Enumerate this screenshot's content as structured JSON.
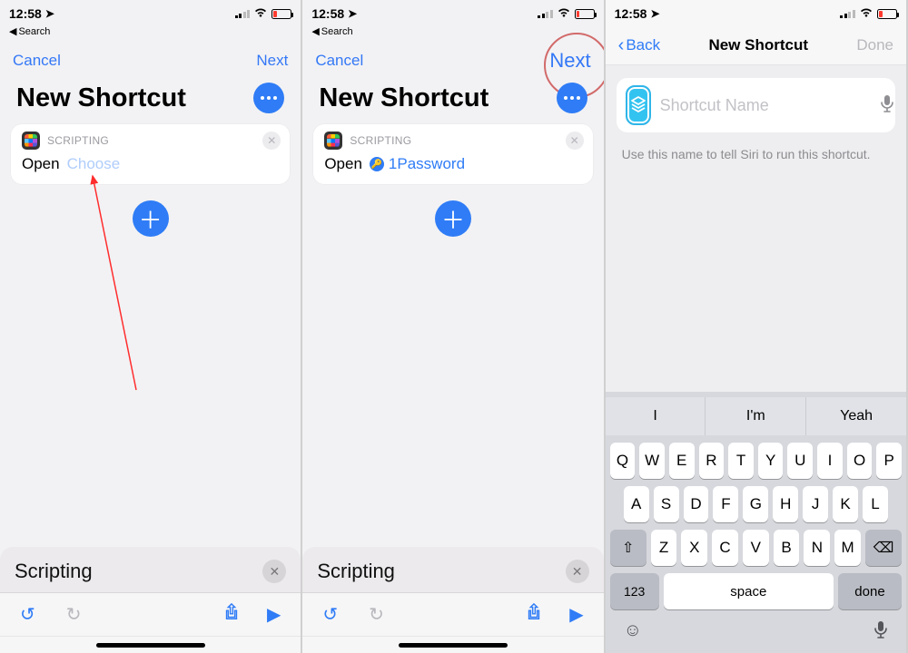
{
  "status": {
    "time": "12:58",
    "back_app": "Search"
  },
  "panel1": {
    "nav": {
      "cancel": "Cancel",
      "next": "Next"
    },
    "title": "New Shortcut",
    "card": {
      "label": "SCRIPTING",
      "open": "Open",
      "param_placeholder": "Choose"
    },
    "search": {
      "text": "Scripting"
    }
  },
  "panel2": {
    "nav": {
      "cancel": "Cancel",
      "next": "Next"
    },
    "title": "New Shortcut",
    "card": {
      "label": "SCRIPTING",
      "open": "Open",
      "app_name": "1Password"
    },
    "search": {
      "text": "Scripting"
    }
  },
  "panel3": {
    "nav": {
      "back": "Back",
      "title": "New Shortcut",
      "done": "Done"
    },
    "field": {
      "placeholder": "Shortcut Name"
    },
    "hint": "Use this name to tell Siri to run this shortcut.",
    "keyboard": {
      "suggestions": [
        "I",
        "I'm",
        "Yeah"
      ],
      "row1": [
        "Q",
        "W",
        "E",
        "R",
        "T",
        "Y",
        "U",
        "I",
        "O",
        "P"
      ],
      "row2": [
        "A",
        "S",
        "D",
        "F",
        "G",
        "H",
        "J",
        "K",
        "L"
      ],
      "row3": [
        "Z",
        "X",
        "C",
        "V",
        "B",
        "N",
        "M"
      ],
      "num_label": "123",
      "space_label": "space",
      "done_label": "done"
    }
  }
}
